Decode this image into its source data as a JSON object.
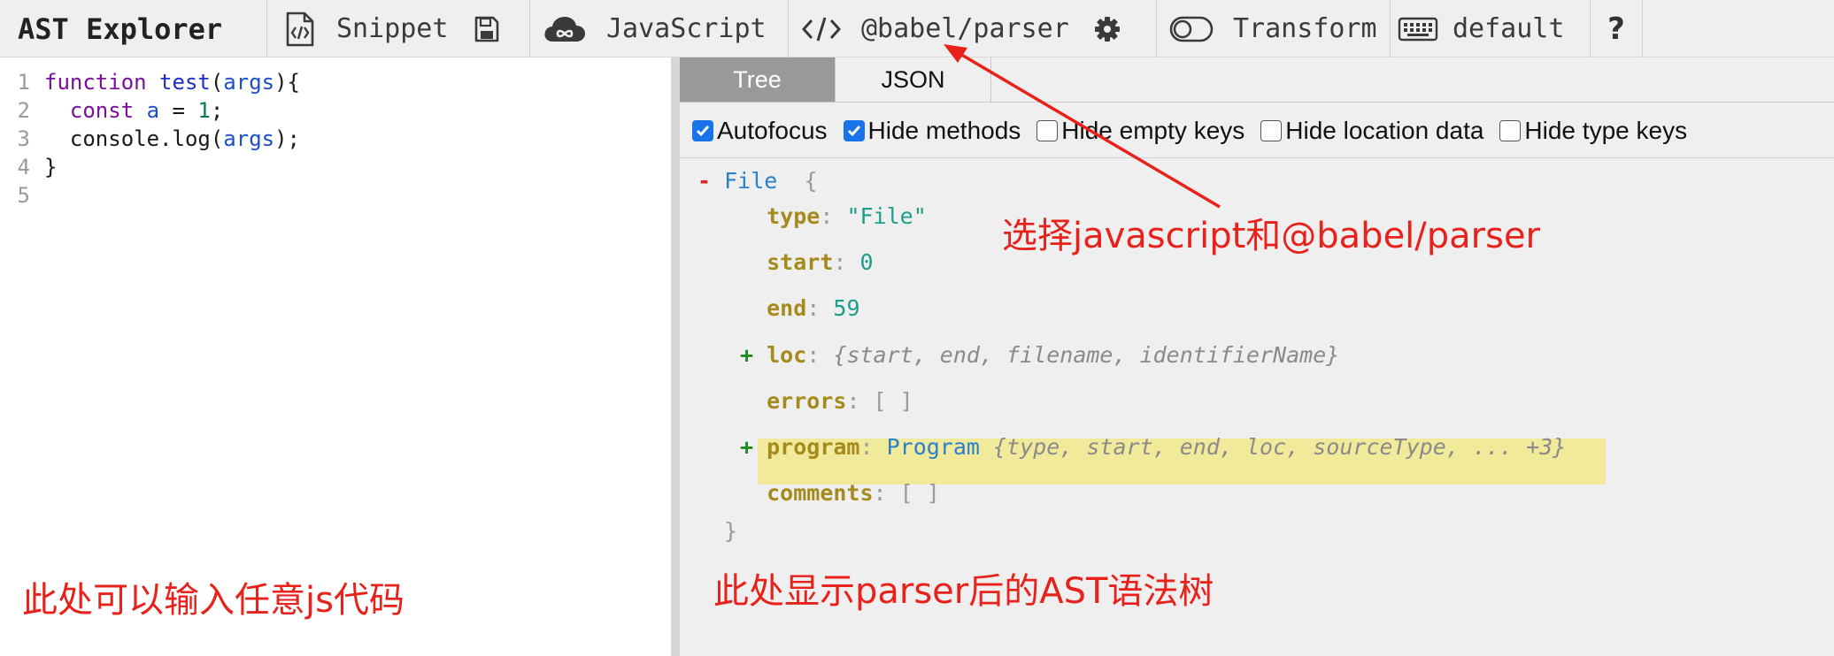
{
  "toolbar": {
    "title": "AST Explorer",
    "snippet_label": "Snippet",
    "language_label": "JavaScript",
    "parser_label": "@babel/parser",
    "transform_label": "Transform",
    "keymap_label": "default",
    "help_label": "?",
    "icons": {
      "snippet": "file-code-icon",
      "save": "save-icon",
      "language": "cloud-infinity-icon",
      "parser": "code-brackets-icon",
      "settings": "gear-icon",
      "transform": "toggle-icon",
      "keymap": "keyboard-icon"
    }
  },
  "editor": {
    "line_numbers": [
      "1",
      "2",
      "3",
      "4",
      "5"
    ],
    "lines": [
      [
        {
          "t": "function",
          "c": "kw"
        },
        {
          "t": " ",
          "c": "txt"
        },
        {
          "t": "test",
          "c": "fn"
        },
        {
          "t": "(",
          "c": "txt"
        },
        {
          "t": "args",
          "c": "var"
        },
        {
          "t": "){",
          "c": "txt"
        }
      ],
      [
        {
          "t": "  ",
          "c": "txt"
        },
        {
          "t": "const",
          "c": "kw"
        },
        {
          "t": " ",
          "c": "txt"
        },
        {
          "t": "a",
          "c": "var"
        },
        {
          "t": " = ",
          "c": "txt"
        },
        {
          "t": "1",
          "c": "num"
        },
        {
          "t": ";",
          "c": "txt"
        }
      ],
      [
        {
          "t": "  console.log(",
          "c": "txt"
        },
        {
          "t": "args",
          "c": "var"
        },
        {
          "t": ");",
          "c": "txt"
        }
      ],
      [
        {
          "t": "}",
          "c": "txt"
        }
      ],
      []
    ]
  },
  "output": {
    "tabs": [
      "Tree",
      "JSON"
    ],
    "options": [
      {
        "label": "Autofocus",
        "checked": true
      },
      {
        "label": "Hide methods",
        "checked": true
      },
      {
        "label": "Hide empty keys",
        "checked": false
      },
      {
        "label": "Hide location data",
        "checked": false
      },
      {
        "label": "Hide type keys",
        "checked": false
      }
    ],
    "tree": {
      "root_toggle": "-",
      "root_name": "File",
      "open_brace": "{",
      "close_brace": "}",
      "rows": [
        {
          "toggle": "",
          "key": "type",
          "value": "\"File\"",
          "kind": "str"
        },
        {
          "toggle": "",
          "key": "start",
          "value": "0",
          "kind": "num"
        },
        {
          "toggle": "",
          "key": "end",
          "value": "59",
          "kind": "num"
        },
        {
          "toggle": "+",
          "key": "loc",
          "value": "{start, end, filename, identifierName}",
          "kind": "summary"
        },
        {
          "toggle": "",
          "key": "errors",
          "value": "[ ]",
          "kind": "punc"
        },
        {
          "toggle": "+",
          "key": "program",
          "node": "Program",
          "value": "{type, start, end, loc, sourceType, ... +3}",
          "kind": "node"
        },
        {
          "toggle": "",
          "key": "comments",
          "value": "[ ]",
          "kind": "punc"
        }
      ]
    }
  },
  "annotations": {
    "select_note": "选择javascript和@babel/parser",
    "editor_note": "此处可以输入任意js代码",
    "output_note": "此处显示parser后的AST语法树",
    "color": "#e8211b"
  }
}
